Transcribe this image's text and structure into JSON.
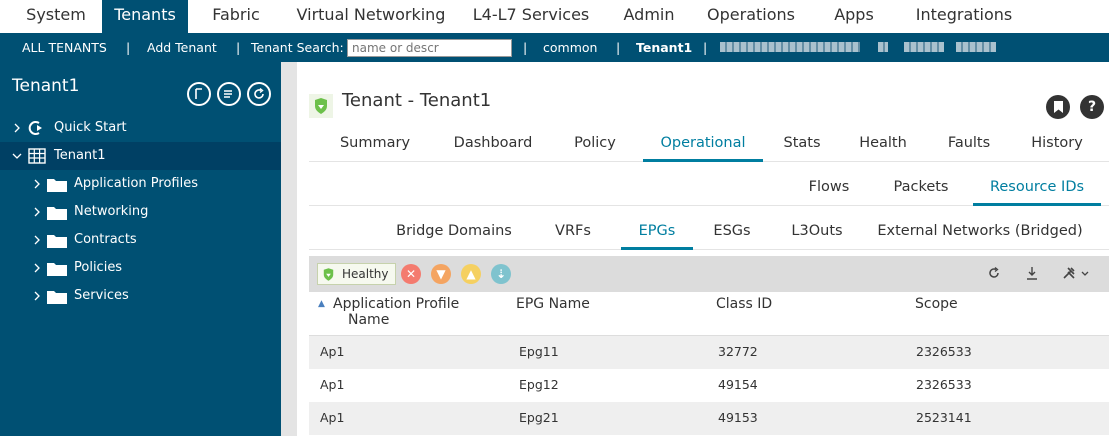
{
  "top_nav": {
    "tabs": [
      "System",
      "Tenants",
      "Fabric",
      "Virtual Networking",
      "L4-L7 Services",
      "Admin",
      "Operations",
      "Apps",
      "Integrations"
    ],
    "active": "Tenants"
  },
  "sub_nav": {
    "all_tenants": "ALL TENANTS",
    "add_tenant": "Add Tenant",
    "tenant_search_label": "Tenant Search:",
    "search_placeholder": "name or descr",
    "common": "common",
    "tenant1": "Tenant1",
    "separator": "|"
  },
  "sidebar": {
    "title": "Tenant1",
    "quick_start": "Quick Start",
    "tenant": "Tenant1",
    "folders": [
      "Application Profiles",
      "Networking",
      "Contracts",
      "Policies",
      "Services"
    ]
  },
  "main": {
    "title": "Tenant - Tenant1",
    "bookmark_icon": "bookmark-icon",
    "help_label": "?",
    "tabs": [
      "Summary",
      "Dashboard",
      "Policy",
      "Operational",
      "Stats",
      "Health",
      "Faults",
      "History"
    ],
    "active_tab": "Operational",
    "sub_tabs": [
      "Flows",
      "Packets",
      "Resource IDs"
    ],
    "active_sub_tab": "Resource IDs",
    "sub_sub_tabs": [
      "Bridge Domains",
      "VRFs",
      "EPGs",
      "ESGs",
      "L3Outs",
      "External Networks (Bridged)"
    ],
    "active_sub_sub_tab": "EPGs",
    "health_badge": "Healthy",
    "severity_colors": {
      "critical": "#f47b6f",
      "major": "#f4a461",
      "minor": "#f5d061",
      "warning": "#7fc3ce"
    },
    "table": {
      "columns": [
        "Application Profile Name",
        "EPG Name",
        "Class ID",
        "Scope"
      ],
      "sort_column": "Application Profile Name",
      "sort_direction": "ascending",
      "rows": [
        [
          "Ap1",
          "Epg11",
          "32772",
          "2326533"
        ],
        [
          "Ap1",
          "Epg12",
          "49154",
          "2326533"
        ],
        [
          "Ap1",
          "Epg21",
          "49153",
          "2523141"
        ]
      ]
    }
  }
}
